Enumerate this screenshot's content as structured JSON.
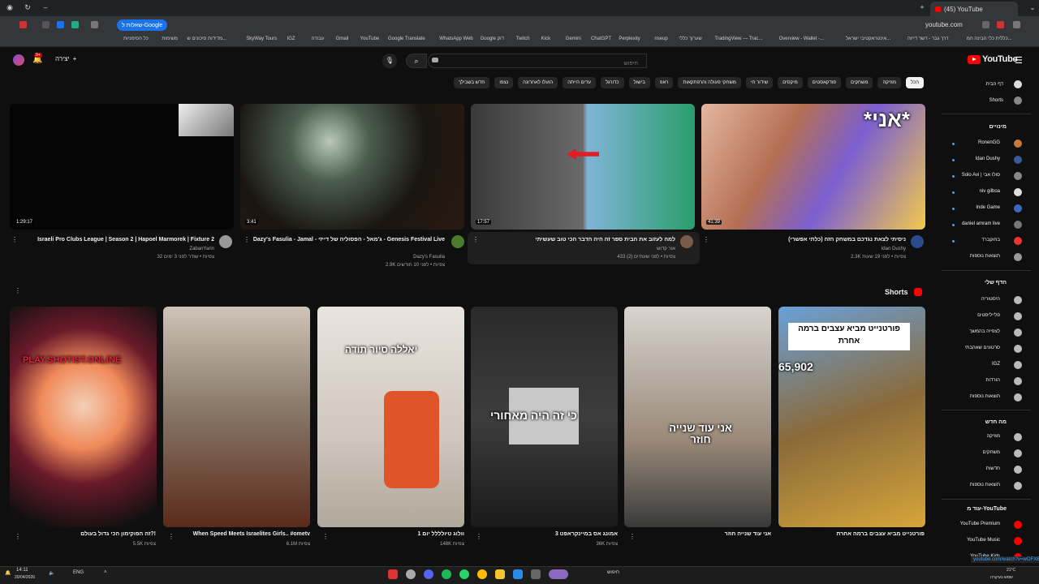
{
  "browser": {
    "tab_title": "(45) YouTube",
    "url": "youtube.com",
    "google_pill": "שאלות ל-Google",
    "bookmarks": [
      "כללית כלי הבינה המ...",
      "דרך גבר - דשר דייזה",
      "אינטראקטיבי ישראל...",
      "Overview - Wallet -...",
      "TradingView — Trac...",
      "שערוך כללי",
      "nseup",
      "Perplexity",
      "ChatGPT",
      "Gemini",
      "Kick",
      "Twitch",
      "Google דוק",
      "WhatsApp Web",
      "Google Translate",
      "YouTube",
      "Gmail",
      "עבודה",
      "IGZ",
      "SkyWay Tours",
      "מדידות סיכונים ש...",
      "משימות",
      "כל הסימניות"
    ]
  },
  "header": {
    "logo": "YouTube",
    "search_placeholder": "חיפוש",
    "search_value": "",
    "create_label": "יצירה",
    "notif_count": "9+"
  },
  "chips": [
    "הכל",
    "מוזיקה",
    "משחקים",
    "פודקאסטים",
    "מיקסים",
    "שידור חי",
    "משחקי פעולה והרפתקאות",
    "ראפ",
    "בישול",
    "כדורגל",
    "עדים הייתה",
    "הועלו לאחרונה",
    "נצפו",
    "חדש בשבילך"
  ],
  "sidebar": {
    "home": "דף הבית",
    "shorts": "Shorts",
    "subs_head": "מינויים",
    "subs": [
      "RonenGG",
      "Idan Dushy",
      "Solo Avi | סולו אבי",
      "niv gilboa",
      "Inde Game",
      "daniel amram live",
      "בחוקברד",
      "תוצאות נוספות"
    ],
    "you_head": "הדף שלי",
    "you": [
      "היסטוריה",
      "פלייליסטים",
      "לצפייה בהמשך",
      "סרטונים שאהבתי",
      "IGZ",
      "הורדות",
      "תוצאות נוספות"
    ],
    "explore_head": "מה חדש",
    "explore": [
      "מוזיקה",
      "משחקים",
      "חדשות",
      "תוצאות נוספות"
    ],
    "more_head": "עוד מ-YouTube",
    "more": [
      "YouTube Premium",
      "YouTube Music",
      "YouTube Kids"
    ]
  },
  "videos": [
    {
      "title": "ניסיתי לצאת נגדכם במשחק הזה (כלתי אפשרי)",
      "channel": "Idan Dushy",
      "meta": "2.3K צפיות • לפני 19 שעות",
      "duration": "41:39"
    },
    {
      "title": "למה לעזוב את הבית ספר זה היה הדבר הכי טוב שעשיתי",
      "channel": "אור קדוש",
      "meta": "433 צפיות • לפני שעתיים (2)",
      "duration": "17:57"
    },
    {
      "title": "Dazy's Fasulia - Jamal - ג'מאל - הפסוליה של דייזי - Genesis Festival Live",
      "channel": "Dazy's Fasulia",
      "meta": "2.9K צפיות • לפני 10 חודשים",
      "duration": "3:41"
    },
    {
      "title": "Israeli Pro Clubs League | Season 2 | Hapoel Marmorek | Fixture 2",
      "channel": "ZabanYarin",
      "meta": "32 צפיות • שודר לפני 3 ימים",
      "duration": "1:29:17"
    }
  ],
  "shorts_head": "Shorts",
  "shorts": [
    {
      "title": "פורטנייט מביא עצבים ברמה אחרת",
      "views": "",
      "overlay": "65,902"
    },
    {
      "title": "אני עוד שנייה חוזר",
      "views": "",
      "overlay": "אני עוד שנייה חוזר"
    },
    {
      "title": "אמונג אס במיינקראפט 3",
      "views": "36K צפיות",
      "overlay": "כי זה היה מאחורי"
    },
    {
      "title": "וולוג טיולללל יום 1",
      "views": "148K צפיות",
      "overlay": "יאללה סיור תודה"
    },
    {
      "title": "When Speed Meets Israelites Girls.. #ometv",
      "views": "6.1M צפיות",
      "overlay": ""
    },
    {
      "title": "זה הפוקימון הכי גדול בעולם?!",
      "views": "5.5K צפיות",
      "overlay": "PLAY.SHOTIST.ONLINE"
    }
  ],
  "taskbar": {
    "time": "14:11",
    "date": "20/04/2026",
    "lang": "ENG",
    "search": "חיפוש",
    "weather": "21°C",
    "weather_desc": "שמש בעיקרה"
  },
  "status_url": "youtube.com/watch?v=wOFXBnGZAuB"
}
